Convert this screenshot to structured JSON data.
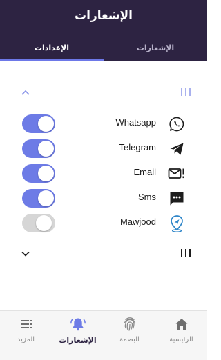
{
  "header": {
    "title": "الإشعارات"
  },
  "tabs": {
    "left": "الإعدادات",
    "right": "الإشعارات"
  },
  "colors": {
    "header_bg": "#2d2342",
    "accent": "#6d78e8",
    "toggle_off": "#d6d6d6"
  },
  "rows": [
    {
      "label": "Whatsapp",
      "icon": "whatsapp-icon",
      "enabled": true
    },
    {
      "label": "Telegram",
      "icon": "telegram-icon",
      "enabled": true
    },
    {
      "label": "Email",
      "icon": "email-alert-icon",
      "enabled": true
    },
    {
      "label": "Sms",
      "icon": "sms-icon",
      "enabled": true
    },
    {
      "label": "Mawjood",
      "icon": "mawjood-location-icon",
      "enabled": false
    }
  ],
  "bottom_nav": [
    {
      "label": "الرئيسية",
      "icon": "home-icon"
    },
    {
      "label": "البصمة",
      "icon": "fingerprint-icon"
    },
    {
      "label": "الإشعارات",
      "icon": "bell-icon",
      "active": true
    },
    {
      "label": "المزيد",
      "icon": "more-menu-icon"
    }
  ]
}
